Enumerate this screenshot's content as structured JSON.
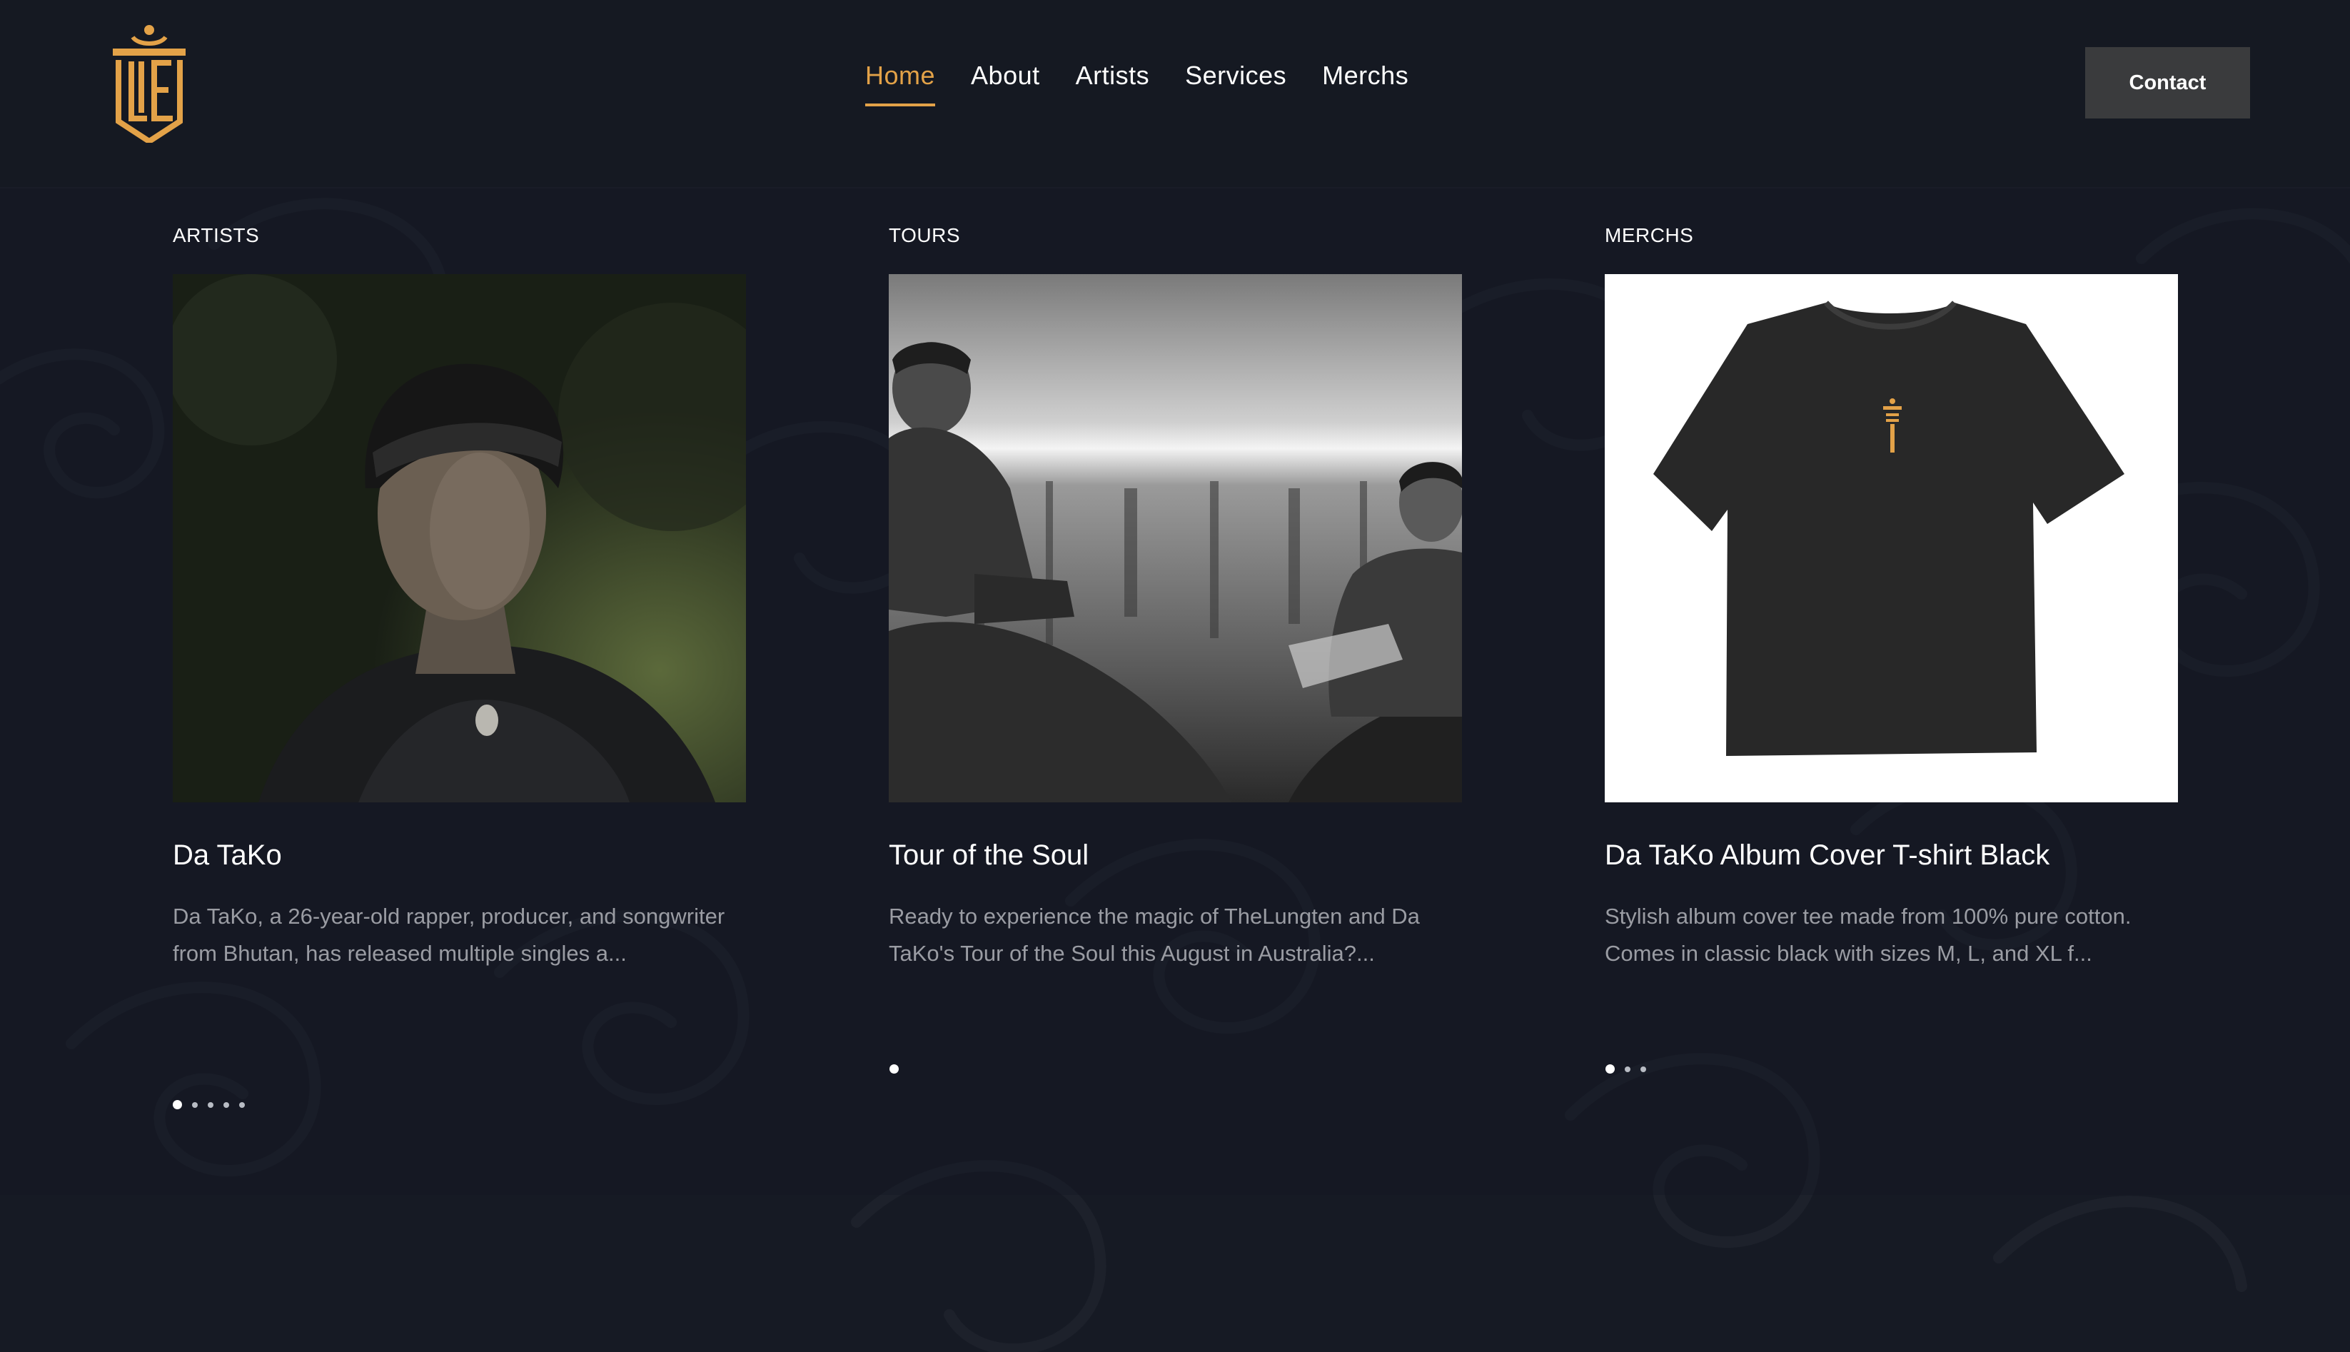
{
  "header": {
    "logo_text": "LTE",
    "nav": [
      {
        "label": "Home",
        "active": true
      },
      {
        "label": "About",
        "active": false
      },
      {
        "label": "Artists",
        "active": false
      },
      {
        "label": "Services",
        "active": false
      },
      {
        "label": "Merchs",
        "active": false
      }
    ],
    "contact_label": "Contact"
  },
  "columns": [
    {
      "section": "ARTISTS",
      "title": "Da TaKo",
      "description": "Da TaKo, a 26-year-old rapper, producer, and songwriter from Bhutan, has released multiple singles a...",
      "image_icon": "artist-photo",
      "dots_count": 5,
      "active_dot": 0
    },
    {
      "section": "TOURS",
      "title": "Tour of the Soul",
      "description": "Ready to experience the magic of TheLungten and Da TaKo's Tour of the Soul this August in Australia?...",
      "image_icon": "tour-photo",
      "dots_count": 1,
      "active_dot": 0
    },
    {
      "section": "MERCHS",
      "title": "Da TaKo Album Cover T-shirt Black",
      "description": "Stylish album cover tee made from 100% pure cotton. Comes in classic black with sizes M, L, and XL f...",
      "image_icon": "tshirt-photo",
      "dots_count": 3,
      "active_dot": 0
    }
  ],
  "colors": {
    "background": "#161a24",
    "accent": "#e3a248",
    "button": "#3a3b3d",
    "text": "#ffffff",
    "muted_text": "#9a9ca3"
  }
}
